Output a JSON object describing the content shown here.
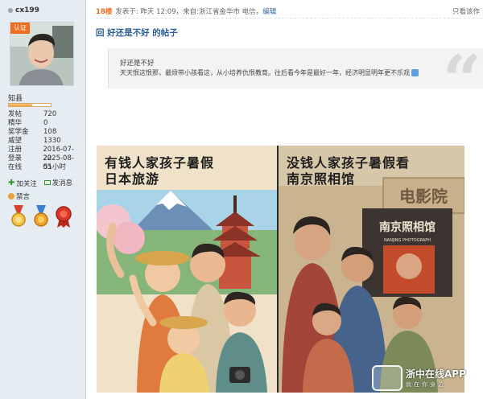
{
  "user": {
    "name": "cx199",
    "verified_badge": "认证",
    "level": "知县",
    "level_progress": 0.55,
    "stats": [
      {
        "label": "发帖",
        "value": "720"
      },
      {
        "label": "精华",
        "value": "0"
      },
      {
        "label": "奖学金",
        "value": "108"
      },
      {
        "label": "威望",
        "value": "1330"
      },
      {
        "label": "注册",
        "value": "2016-07-22"
      },
      {
        "label": "登录",
        "value": "2025-08-05"
      },
      {
        "label": "在线",
        "value": "51小时"
      }
    ],
    "actions": {
      "follow": "加关注",
      "message": "发消息",
      "ban": "禁言"
    },
    "medals": [
      "gold-medal-icon",
      "sun-medal-icon",
      "red-award-icon"
    ]
  },
  "post": {
    "floor": "18楼",
    "meta": "发表于: 昨天 12:09，来自:浙江省金华市 电信，",
    "edit_link": "编辑",
    "only_read": "只看该作",
    "title": "回 好还是不好 的帖子",
    "quote_line1": "好还是不好",
    "quote_line2": "天天恨这恨那，最烦带小孩看这，从小培养仇恨教育。往后看今年是最好一年，经济明显明年更不乐观"
  },
  "image": {
    "left_caption_line1": "有钱人家孩子暑假",
    "left_caption_line2": "日本旅游",
    "right_caption_line1": "没钱人家孩子暑假看",
    "right_caption_line2": "南京照相馆",
    "cinema_sign": "电影院",
    "studio_sign": "南京照相馆",
    "studio_sign_en": "NANJING PHOTOGRAPH",
    "watermark_line1": "浙中在线APP",
    "watermark_line2": "就在你身边"
  },
  "colors": {
    "accent": "#f26c1d",
    "link": "#2b5f95",
    "sidebar_bg": "#e5edf2"
  }
}
